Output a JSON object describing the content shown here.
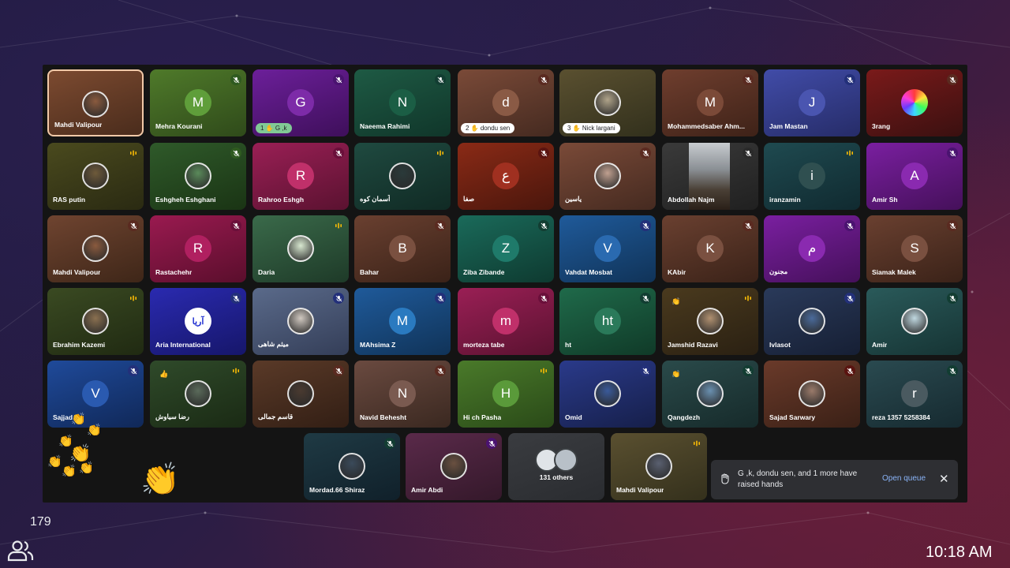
{
  "participant_count": "179",
  "clock": "10:18 AM",
  "toast": {
    "message": "G ,k, dondu sen, and 1 more have raised hands",
    "action": "Open queue",
    "close": "✕"
  },
  "reactions": {
    "big_clap": "👏",
    "small_clap": "👏"
  },
  "rows": [
    [
      {
        "name": "Mahdi Valipour",
        "photo": "#8a5a3e",
        "bg": [
          "#7c4a30",
          "#4a2c1c"
        ],
        "mic": "none",
        "active": true
      },
      {
        "name": "Mehra Kourani",
        "letter": "M",
        "av": "#5f9e3a",
        "bg": [
          "#4f7a2a",
          "#2f4a1a"
        ],
        "mic": "muted-green"
      },
      {
        "badge": "1 ✋ G ,k",
        "badge_green": true,
        "letter": "G",
        "av": "#7d2ba8",
        "bg": [
          "#6c1f9a",
          "#3e0f5a"
        ],
        "mic": "muted-purple"
      },
      {
        "name": "Naeema Rahimi",
        "letter": "N",
        "av": "#1b5e45",
        "bg": [
          "#1e5a44",
          "#10362a"
        ],
        "mic": "muted-teal"
      },
      {
        "badge": "2 ✋ dondu sen",
        "letter": "d",
        "av": "#8a5a45",
        "bg": [
          "#7a4a38",
          "#452a20"
        ],
        "mic": "muted-brown"
      },
      {
        "badge": "3 ✋ Nick largani",
        "photo": "#b0a48a",
        "bg": [
          "#5a5030",
          "#32301c"
        ],
        "mic": "none"
      },
      {
        "name": "Mohammedsaber Ahm...",
        "letter": "M",
        "av": "#7b4a38",
        "bg": [
          "#6f3e2e",
          "#3e2218"
        ],
        "mic": "muted-brown"
      },
      {
        "name": "Jam Mastan",
        "letter": "J",
        "av": "#4a55b0",
        "bg": [
          "#414ca8",
          "#262c68"
        ],
        "mic": "muted-blue"
      },
      {
        "name": "3rang",
        "photo": "rainbow",
        "bg": [
          "#7a1a1a",
          "#3a1010"
        ],
        "mic": "muted-brown"
      }
    ],
    [
      {
        "name": "RAS putin",
        "photo": "#6e5a3a",
        "bg": [
          "#4a4a1e",
          "#2a2a12"
        ],
        "mic": "wave"
      },
      {
        "name": "Eshgheh Eshghani",
        "photo": "#5a8a5a",
        "bg": [
          "#2f5a2a",
          "#1a3414"
        ],
        "mic": "muted-green"
      },
      {
        "name": "Rahroo Eshgh",
        "letter": "R",
        "av": "#c0306a",
        "bg": [
          "#9a1f55",
          "#5a1230"
        ],
        "mic": "muted-pink"
      },
      {
        "name": "آسمان کوه",
        "photo": "#2a3a3a",
        "bg": [
          "#1f4a40",
          "#102a24"
        ],
        "mic": "wave"
      },
      {
        "name": "صفا",
        "letter": "ع",
        "av": "#a03020",
        "bg": [
          "#8a2a16",
          "#4a160c"
        ],
        "mic": "muted-red"
      },
      {
        "name": "یاسین",
        "photo": "#c0a090",
        "bg": [
          "#7a4a38",
          "#452a20"
        ],
        "mic": "muted-brown"
      },
      {
        "name": "Abdollah Najm",
        "video": true,
        "bg": [
          "#3a3a3a",
          "#202020"
        ],
        "mic": "muted-dark"
      },
      {
        "name": "iranzamin",
        "letter": "i",
        "av": "#2f4f50",
        "bg": [
          "#1f4a50",
          "#102a30"
        ],
        "mic": "wave"
      },
      {
        "name": "Amir Sh",
        "letter": "A",
        "av": "#8a2ab0",
        "bg": [
          "#7a1fa0",
          "#45105a"
        ],
        "mic": "muted-purple"
      }
    ],
    [
      {
        "name": "Mahdi Valipour",
        "photo": "#8a5a3e",
        "bg": [
          "#6f4430",
          "#3e2618"
        ],
        "mic": "muted-brown"
      },
      {
        "name": "Rastachehr",
        "letter": "R",
        "av": "#b02060",
        "bg": [
          "#9a1a50",
          "#5a0e2c"
        ],
        "mic": "muted-pink"
      },
      {
        "name": "Daria",
        "photo": "#d8e8d0",
        "bg": [
          "#3a6a4a",
          "#1e3a28"
        ],
        "mic": "wave"
      },
      {
        "name": "Bahar",
        "letter": "B",
        "av": "#7a5040",
        "bg": [
          "#6a4030",
          "#3a2218"
        ],
        "mic": "muted-brown"
      },
      {
        "name": "Ziba Zibande",
        "letter": "Z",
        "av": "#1f7a6a",
        "bg": [
          "#1a6a5a",
          "#0e3a30"
        ],
        "mic": "muted-teal"
      },
      {
        "name": "Vahdat Mosbat",
        "letter": "V",
        "av": "#2a6ab0",
        "bg": [
          "#1f5a9a",
          "#103358"
        ],
        "mic": "muted-blue"
      },
      {
        "name": "KAbir",
        "letter": "K",
        "av": "#7a5040",
        "bg": [
          "#6a4030",
          "#3a2218"
        ],
        "mic": "muted-brown"
      },
      {
        "name": "مجنون",
        "letter": "م",
        "av": "#8a2ab0",
        "bg": [
          "#7a1fa0",
          "#45105a"
        ],
        "mic": "muted-purple"
      },
      {
        "name": "Siamak Malek",
        "letter": "S",
        "av": "#7a5040",
        "bg": [
          "#6a4030",
          "#3a2218"
        ],
        "mic": "muted-brown"
      }
    ],
    [
      {
        "name": "Ebrahim Kazemi",
        "photo": "#8a7050",
        "bg": [
          "#3a4a22",
          "#202a12"
        ],
        "mic": "wave"
      },
      {
        "name": "Aria International",
        "logo": "آریا",
        "bg": [
          "#2a2ab0",
          "#16166a"
        ],
        "mic": "muted-blue"
      },
      {
        "name": "میثم شاهی",
        "photo": "#d0c8c0",
        "bg": [
          "#5a6a8a",
          "#343e58"
        ],
        "mic": "muted-blue"
      },
      {
        "name": "MAhsima Z",
        "letter": "M",
        "av": "#2a7ac0",
        "bg": [
          "#1f5a9a",
          "#103358"
        ],
        "mic": "muted-blue"
      },
      {
        "name": "morteza tabe",
        "letter": "m",
        "av": "#c0306a",
        "bg": [
          "#9a1f55",
          "#5a1230"
        ],
        "mic": "muted-pink"
      },
      {
        "name": "ht",
        "letter": "ht",
        "av": "#2a7a5a",
        "bg": [
          "#1f6a4a",
          "#103a28"
        ],
        "mic": "muted-teal"
      },
      {
        "name": "Jamshid Razavi",
        "photo": "#b09070",
        "emoji": "👏",
        "bg": [
          "#4a3a1e",
          "#2a2012"
        ],
        "mic": "wave"
      },
      {
        "name": "Ivlasot",
        "photo": "#4a6a9a",
        "bg": [
          "#2a3a5a",
          "#161f34"
        ],
        "mic": "muted-blue"
      },
      {
        "name": "Amir",
        "photo": "#c0d8e0",
        "bg": [
          "#2a5a5a",
          "#163434"
        ],
        "mic": "muted-teal"
      }
    ],
    [
      {
        "name": "Sajjad",
        "letter": "V",
        "av": "#2a5ab0",
        "bg": [
          "#1f4a9a",
          "#102858"
        ],
        "mic": "muted-blue"
      },
      {
        "name": "رضا سیاوش",
        "photo": "#5a6a5a",
        "emoji": "👍",
        "bg": [
          "#2f4a2a",
          "#1a2a14"
        ],
        "mic": "wave"
      },
      {
        "name": "قاسم جمالی",
        "photo": "#4a3a30",
        "bg": [
          "#5a3a28",
          "#321e14"
        ],
        "mic": "muted-brown"
      },
      {
        "name": "Navid Behesht",
        "letter": "N",
        "av": "#7a5a50",
        "bg": [
          "#6a4a40",
          "#3a2820"
        ],
        "mic": "muted-brown"
      },
      {
        "name": "Hi ch Pasha",
        "letter": "H",
        "av": "#5a9a3a",
        "bg": [
          "#4a7a2a",
          "#2a4a18"
        ],
        "mic": "wave"
      },
      {
        "name": "Omid",
        "photo": "#3a5a9a",
        "bg": [
          "#2a3a8a",
          "#161f4a"
        ],
        "mic": "muted-blue"
      },
      {
        "name": "Qangdezh",
        "photo": "#6a90b0",
        "emoji": "👏",
        "bg": [
          "#2a4a4a",
          "#162a2a"
        ],
        "mic": "muted-teal"
      },
      {
        "name": "Sajad Sarwary",
        "photo": "#9a7a6a",
        "bg": [
          "#6a3a2a",
          "#3a2016"
        ],
        "mic": "muted-red"
      },
      {
        "name": "reza 1357 5258384",
        "letter": "r",
        "av": "#4a5a60",
        "bg": [
          "#2a4a50",
          "#162a30"
        ],
        "mic": "muted-teal"
      }
    ]
  ],
  "bottom_row": [
    {
      "name": "Mordad.66 Shiraz",
      "photo": "#3a4a5a",
      "bg": [
        "#1f3a44",
        "#10202a"
      ],
      "mic": "muted-teal"
    },
    {
      "name": "Amir Abdi",
      "photo": "#6a5040",
      "bg": [
        "#5a2a4a",
        "#34182a"
      ],
      "mic": "muted-purple"
    },
    {
      "name": "131 others",
      "others": true,
      "bg": [
        "#3a3c40",
        "#2a2c30"
      ],
      "mic": "none"
    },
    {
      "name": "Mahdi Valipour",
      "photo": "#5a6070",
      "bg": [
        "#5a5030",
        "#34301c"
      ],
      "mic": "wave"
    }
  ]
}
